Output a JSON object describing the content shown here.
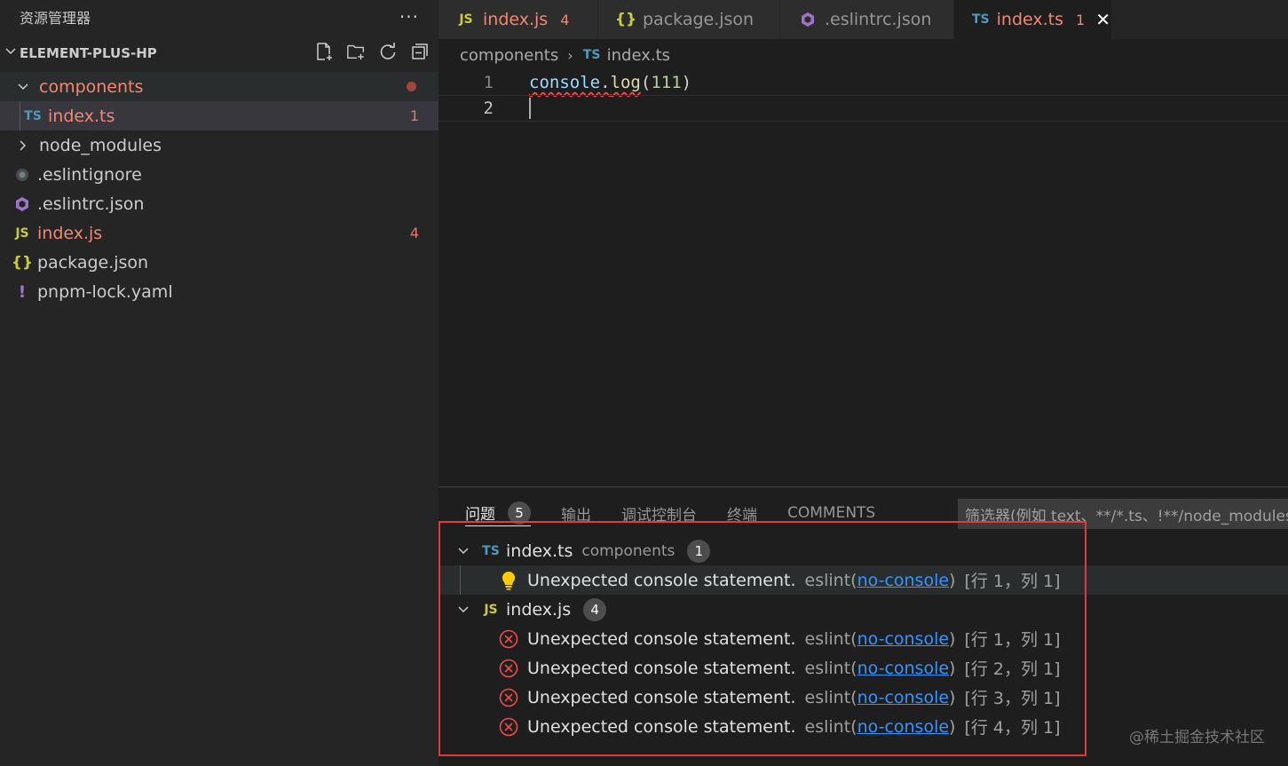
{
  "sidebar": {
    "title": "资源管理器",
    "more": "···",
    "project": "ELEMENT-PLUS-HP",
    "tree": [
      {
        "label": "components",
        "icon": "chevron-down-icon",
        "badge": "",
        "level": 1
      },
      {
        "label": "index.ts",
        "icon": "ts-file-icon",
        "icon_text": "TS",
        "badge": "1",
        "level": 2
      },
      {
        "label": "node_modules",
        "icon": "chevron-right-icon",
        "badge": "",
        "level": 1
      },
      {
        "label": ".eslintignore",
        "icon": "eslintignore-file-icon",
        "badge": "",
        "level": 1
      },
      {
        "label": ".eslintrc.json",
        "icon": "eslint-file-icon",
        "badge": "",
        "level": 1
      },
      {
        "label": "index.js",
        "icon": "js-file-icon",
        "icon_text": "JS",
        "badge": "4",
        "level": 1
      },
      {
        "label": "package.json",
        "icon": "json-file-icon",
        "icon_text": "{}",
        "badge": "",
        "level": 1
      },
      {
        "label": "pnpm-lock.yaml",
        "icon": "yaml-file-icon",
        "icon_text": "!",
        "badge": "",
        "level": 1
      }
    ]
  },
  "tabs": [
    {
      "label": "index.js",
      "icon_text": "JS",
      "badge": "4"
    },
    {
      "label": "package.json",
      "icon_text": "{}",
      "badge": ""
    },
    {
      "label": ".eslintrc.json",
      "icon_text": "",
      "badge": ""
    },
    {
      "label": "index.ts",
      "icon_text": "TS",
      "badge": "1",
      "close": "✕"
    }
  ],
  "breadcrumb": {
    "folder": "components",
    "sep": "›",
    "icon_text": "TS",
    "file": "index.ts"
  },
  "editor": {
    "lines": [
      {
        "num": "1",
        "tokens": {
          "obj": "console",
          "dot": ".",
          "fn": "log",
          "open": "(",
          "arg": "111",
          "close": ")"
        }
      },
      {
        "num": "2"
      }
    ]
  },
  "panel": {
    "tabs": [
      {
        "label": "问题",
        "count": "5"
      },
      {
        "label": "输出"
      },
      {
        "label": "调试控制台"
      },
      {
        "label": "终端"
      },
      {
        "label": "COMMENTS"
      }
    ],
    "filter_placeholder": "筛选器(例如 text、**/*.ts、!**/node_modules/**)",
    "groups": [
      {
        "file": "index.ts",
        "icon_text": "TS",
        "dir": "components",
        "count": "1",
        "items": [
          {
            "severity": "warning-bulb",
            "message": "Unexpected console statement.",
            "source": "eslint(",
            "rule": "no-console",
            "source_end": ")",
            "pos": "[行 1，列 1]"
          }
        ]
      },
      {
        "file": "index.js",
        "icon_text": "JS",
        "dir": "",
        "count": "4",
        "items": [
          {
            "severity": "error",
            "message": "Unexpected console statement.",
            "source": "eslint(",
            "rule": "no-console",
            "source_end": ")",
            "pos": "[行 1，列 1]"
          },
          {
            "severity": "error",
            "message": "Unexpected console statement.",
            "source": "eslint(",
            "rule": "no-console",
            "source_end": ")",
            "pos": "[行 2，列 1]"
          },
          {
            "severity": "error",
            "message": "Unexpected console statement.",
            "source": "eslint(",
            "rule": "no-console",
            "source_end": ")",
            "pos": "[行 3，列 1]"
          },
          {
            "severity": "error",
            "message": "Unexpected console statement.",
            "source": "eslint(",
            "rule": "no-console",
            "source_end": ")",
            "pos": "[行 4，列 1]"
          }
        ]
      }
    ]
  },
  "watermark": "@稀土掘金技术社区",
  "colors": {
    "error": "#f14c4c",
    "warning": "#ffcc00",
    "link": "#3794ff",
    "highlight_box": "#e5383b"
  }
}
